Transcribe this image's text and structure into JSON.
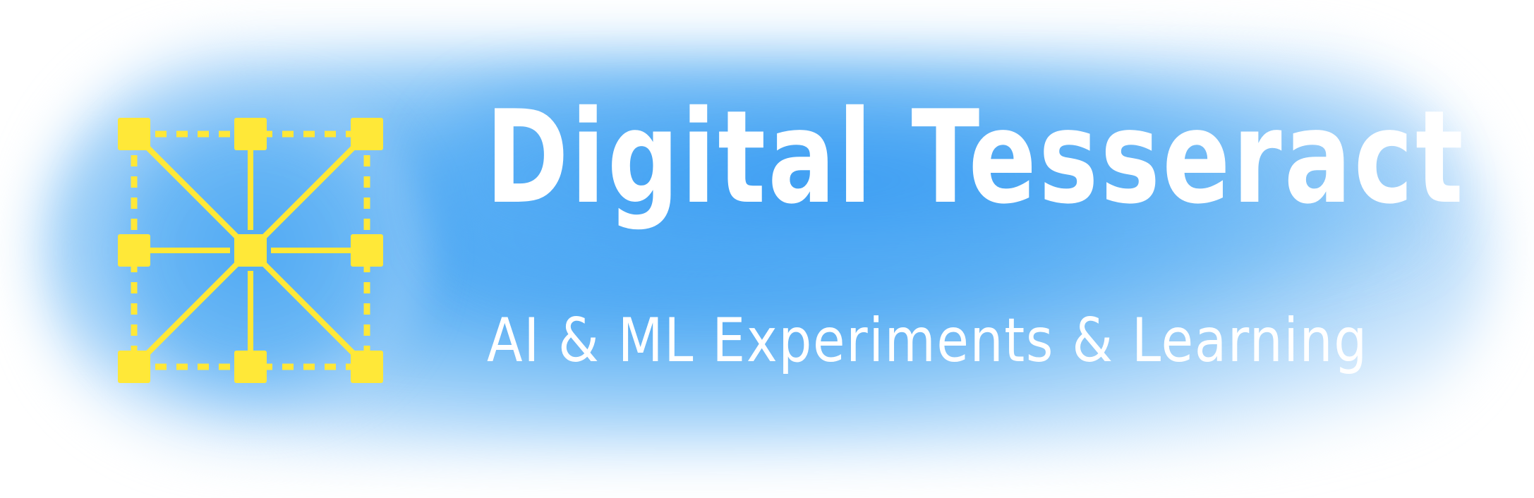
{
  "brand": {
    "title": "Digital Tesseract",
    "tagline": "AI & ML Experiments & Learning",
    "logo_icon": "tesseract-grid-icon"
  },
  "colors": {
    "accent": "#ffe838",
    "glow": "#3ea0f3",
    "text": "#ffffff",
    "background": "#ffffff"
  }
}
